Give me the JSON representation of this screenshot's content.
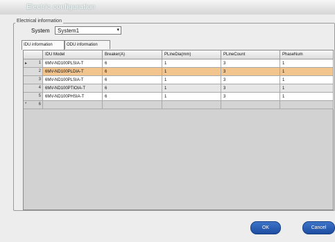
{
  "window": {
    "title": "Electric configuration"
  },
  "group": {
    "legend": "Electrical information"
  },
  "system": {
    "label": "System",
    "value": "System1",
    "arrow": "▾"
  },
  "tabs": [
    {
      "label": "IDU information",
      "active": true
    },
    {
      "label": "ODU information",
      "active": false
    }
  ],
  "grid": {
    "columns": [
      "IDU Model",
      "Breaker(A)",
      "PLineDia(mm)",
      "PLineCount",
      "PhaseNum"
    ],
    "rows": [
      {
        "num": "1",
        "indicator": "▸",
        "cells": [
          "6MV-ND100PLSIA-T",
          "6",
          "1",
          "3",
          "1"
        ]
      },
      {
        "num": "2",
        "indicator": "",
        "cells": [
          "6MV-ND100PLDIA-T",
          "6",
          "1",
          "3",
          "1"
        ]
      },
      {
        "num": "3",
        "indicator": "",
        "cells": [
          "6MV-ND100PLSIA-T",
          "6",
          "1",
          "3",
          "1"
        ]
      },
      {
        "num": "4",
        "indicator": "",
        "cells": [
          "6MV-ND100PTIOIA-T",
          "6",
          "1",
          "3",
          "1"
        ]
      },
      {
        "num": "5",
        "indicator": "",
        "cells": [
          "6MV-ND100PHSIA-T",
          "6",
          "1",
          "3",
          "1"
        ]
      }
    ],
    "new_row": {
      "num": "6",
      "indicator": "*"
    }
  },
  "buttons": {
    "ok": "OK",
    "cancel": "Cancel"
  },
  "colors": {
    "selected_row": "#f2c48e",
    "button": "#2a5db5"
  }
}
